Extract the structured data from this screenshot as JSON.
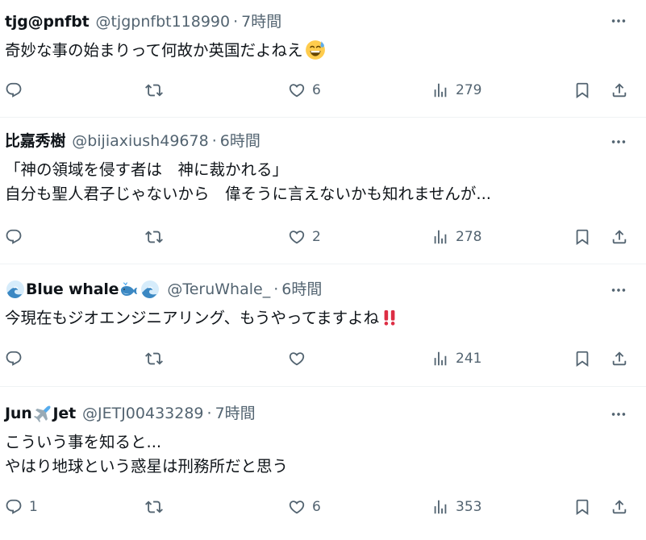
{
  "tweets": [
    {
      "name": "tjg@pnfbt",
      "name_emojis": [],
      "handle": "@tjgpnfbt118990",
      "time": "7時間",
      "lines": [
        "奇妙な事の始まりって何故か英国だよねえ"
      ],
      "trailing_emoji": "grinning-sweat-emoji",
      "replies": "",
      "retweets": "",
      "likes": "6",
      "views": "279"
    },
    {
      "name": "比嘉秀樹",
      "name_emojis": [],
      "handle": "@bijiaxiush49678",
      "time": "6時間",
      "lines": [
        "「神の領域を侵す者は　神に裁かれる」",
        "自分も聖人君子じゃないから　偉そうに言えないかも知れませんが..."
      ],
      "trailing_emoji": "",
      "replies": "",
      "retweets": "",
      "likes": "2",
      "views": "278"
    },
    {
      "name": "Blue whale",
      "name_emojis": [
        "wave-emoji",
        "whale-emoji",
        "wave-emoji"
      ],
      "handle": "@TeruWhale_",
      "time": "6時間",
      "lines": [
        "今現在もジオエンジニアリング、もうやってますよね"
      ],
      "trailing_emoji": "double-exclamation-emoji",
      "replies": "",
      "retweets": "",
      "likes": "",
      "views": "241"
    },
    {
      "name_pre": "Jun",
      "name_post": "Jet",
      "name_emojis": [
        "airplane-emoji"
      ],
      "handle": "@JETJ00433289",
      "time": "7時間",
      "lines": [
        "こういう事を知ると...",
        "やはり地球という惑星は刑務所だと思う"
      ],
      "trailing_emoji": "",
      "replies": "1",
      "retweets": "",
      "likes": "6",
      "views": "353"
    }
  ],
  "separator": "·",
  "icons": {
    "reply": "reply-icon",
    "retweet": "retweet-icon",
    "like": "heart-icon",
    "views": "views-icon",
    "bookmark": "bookmark-icon",
    "share": "share-icon",
    "more": "more-icon"
  },
  "colors": {
    "text": "#0f1419",
    "secondary": "#536471",
    "divider": "#eff3f4"
  }
}
